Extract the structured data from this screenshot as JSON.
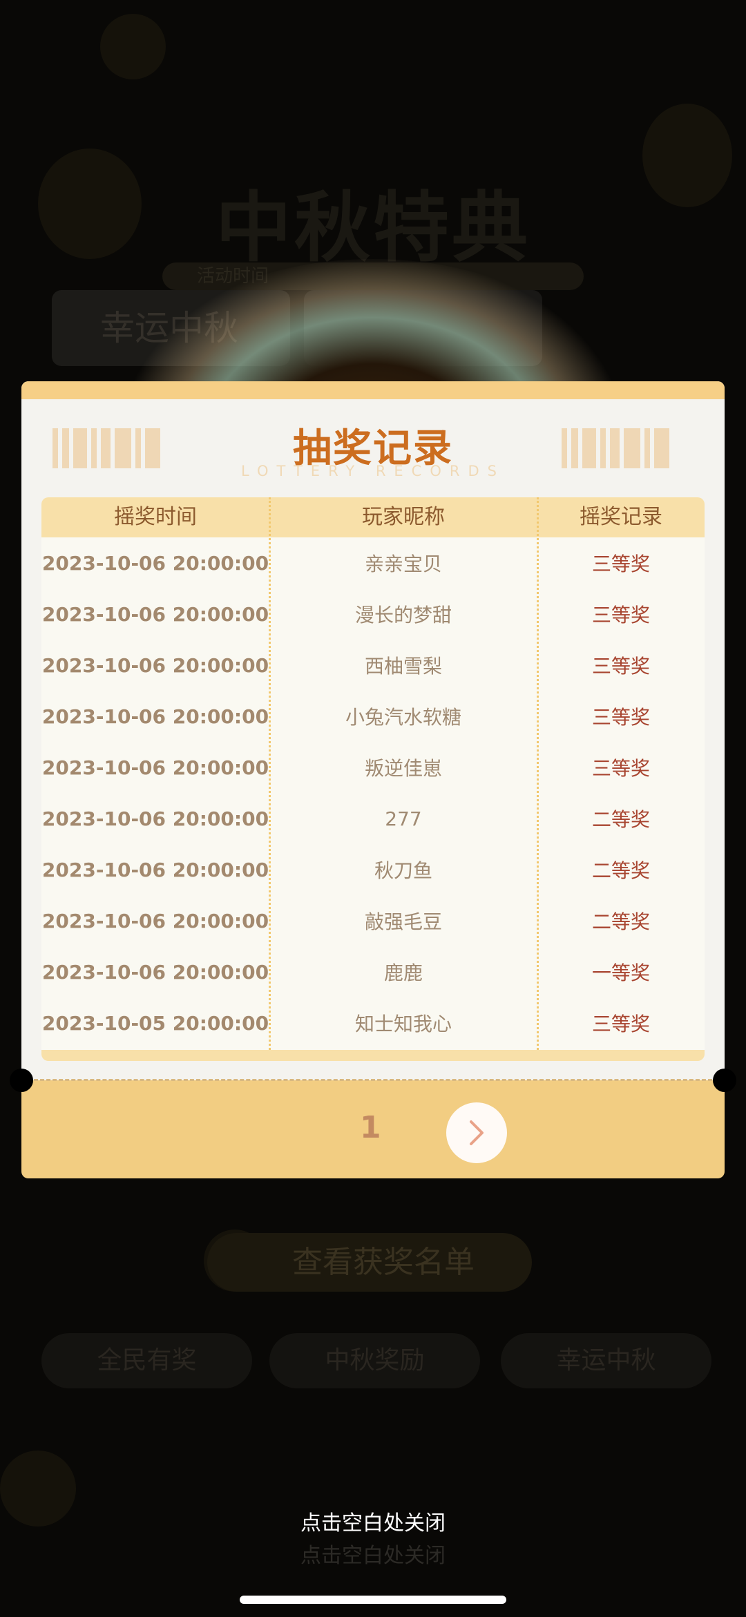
{
  "background": {
    "title": "中秋特典",
    "subbar_text": "活动时间",
    "tabs": [
      "幸运中秋",
      ""
    ],
    "view_winners_label": "查看获奖名单",
    "pills": [
      "全民有奖",
      "中秋奖励",
      "幸运中秋"
    ]
  },
  "modal": {
    "title": "抽奖记录",
    "subtitle": "LOTTERY RECORDS",
    "columns": [
      "摇奖时间",
      "玩家昵称",
      "摇奖记录"
    ],
    "rows": [
      {
        "time": "2023-10-06 20:00:00",
        "nickname": "亲亲宝贝",
        "record": "三等奖"
      },
      {
        "time": "2023-10-06 20:00:00",
        "nickname": "漫长的梦甜",
        "record": "三等奖"
      },
      {
        "time": "2023-10-06 20:00:00",
        "nickname": "西柚雪梨",
        "record": "三等奖"
      },
      {
        "time": "2023-10-06 20:00:00",
        "nickname": "小兔汽水软糖",
        "record": "三等奖"
      },
      {
        "time": "2023-10-06 20:00:00",
        "nickname": "叛逆佳崽",
        "record": "三等奖"
      },
      {
        "time": "2023-10-06 20:00:00",
        "nickname": "277",
        "record": "二等奖"
      },
      {
        "time": "2023-10-06 20:00:00",
        "nickname": "秋刀鱼",
        "record": "二等奖"
      },
      {
        "time": "2023-10-06 20:00:00",
        "nickname": "敲强毛豆",
        "record": "二等奖"
      },
      {
        "time": "2023-10-06 20:00:00",
        "nickname": "鹿鹿",
        "record": "一等奖"
      },
      {
        "time": "2023-10-05 20:00:00",
        "nickname": "知士知我心",
        "record": "三等奖"
      }
    ],
    "page_number": "1",
    "next_icon": "chevron-right-icon"
  },
  "close_hint": "点击空白处关闭",
  "colors": {
    "title": "#cc6d1f",
    "header_bg": "#f8e0a9",
    "footer_bg": "#f2cd82",
    "prize_text": "#a84530"
  }
}
